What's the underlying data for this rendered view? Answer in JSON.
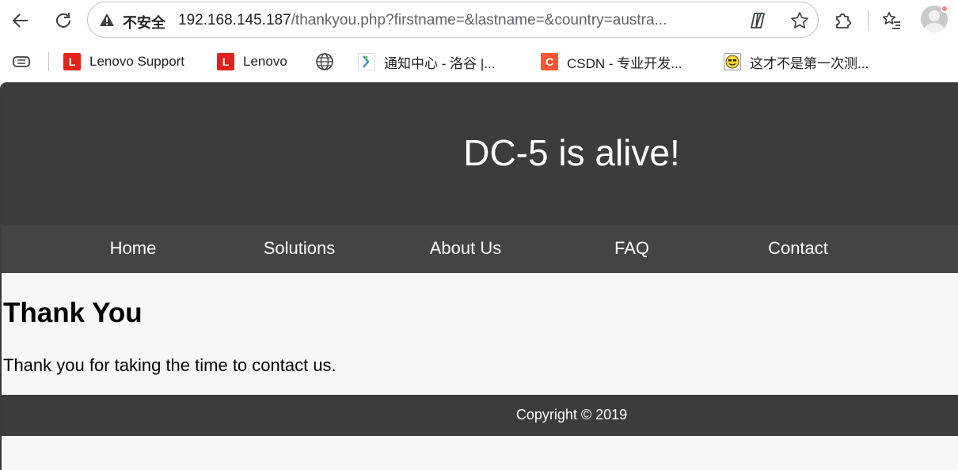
{
  "browser": {
    "security_label": "不安全",
    "url_host": "192.168.145.187",
    "url_path": "/thankyou.php?firstname=&lastname=&country=austra...",
    "bookmarks": [
      {
        "label": "Lenovo Support",
        "icon": "lenovo-icon"
      },
      {
        "label": "Lenovo",
        "icon": "lenovo-icon"
      },
      {
        "label": "",
        "icon": "globe-icon"
      },
      {
        "label": "通知中心 - 洛谷 |...",
        "icon": "luogu-icon"
      },
      {
        "label": "CSDN - 专业开发...",
        "icon": "csdn-icon"
      },
      {
        "label": "这才不是第一次测...",
        "icon": "smiley-icon"
      }
    ]
  },
  "site": {
    "title": "DC-5 is alive!",
    "nav": [
      "Home",
      "Solutions",
      "About Us",
      "FAQ",
      "Contact"
    ],
    "heading": "Thank You",
    "message": "Thank you for taking the time to contact us.",
    "footer": "Copyright © 2019"
  },
  "colors": {
    "header_bg": "#3c3c3c",
    "nav_bg": "#444444",
    "page_bg": "#f7f7f7",
    "lenovo_red": "#e2231a",
    "csdn_orange": "#fc5531"
  }
}
